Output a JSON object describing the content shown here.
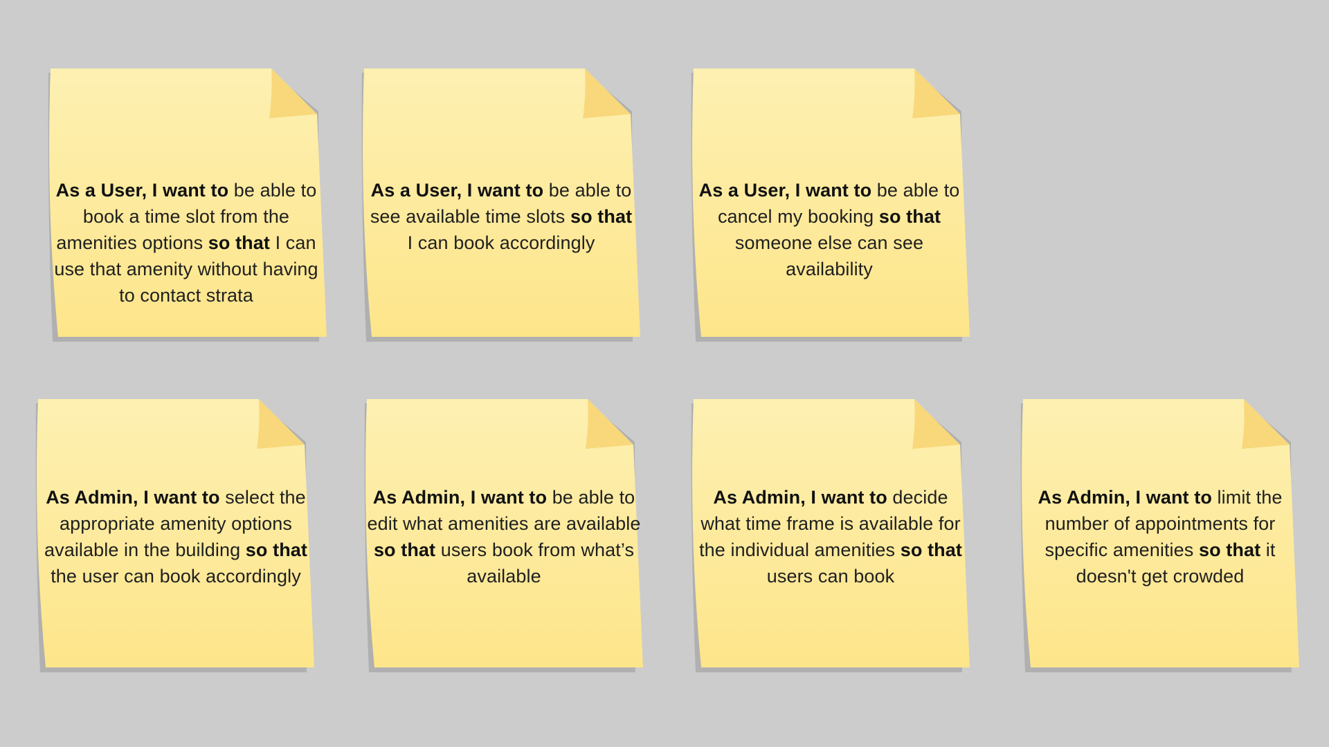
{
  "colors": {
    "background": "#cccccc",
    "note_top": "#fdf0b2",
    "note_bottom": "#fde58a",
    "fold": "#f8d87a",
    "shadow": "#b0b0b0"
  },
  "notes": [
    {
      "role": "As a User, I want to",
      "want": " be able to book a time slot from the amenities options ",
      "so_that": "so that",
      "benefit": " I can use that amenity without having to contact strata"
    },
    {
      "role": "As a User, I want to",
      "want": " be able to see available time slots ",
      "so_that": "so that",
      "benefit": " I can book accordingly"
    },
    {
      "role": "As a User, I want to",
      "want": " be able to cancel my booking ",
      "so_that": "so that",
      "benefit": " someone else can see availability"
    },
    {
      "role": "As Admin, I want to",
      "want": " select the appropriate amenity options available in the building ",
      "so_that": "so that",
      "benefit": " the user can book accordingly"
    },
    {
      "role": "As Admin, I want to",
      "want": " be able to edit what amenities are available ",
      "so_that": "so that",
      "benefit": " users book from what’s available"
    },
    {
      "role": "As Admin, I want to",
      "want": " decide what time frame is available for the individual amenities ",
      "so_that": "so that",
      "benefit": " users can book"
    },
    {
      "role": "As Admin, I want to",
      "want": " limit the number of appointments for specific amenities ",
      "so_that": "so that",
      "benefit": " it doesn't get crowded"
    }
  ]
}
